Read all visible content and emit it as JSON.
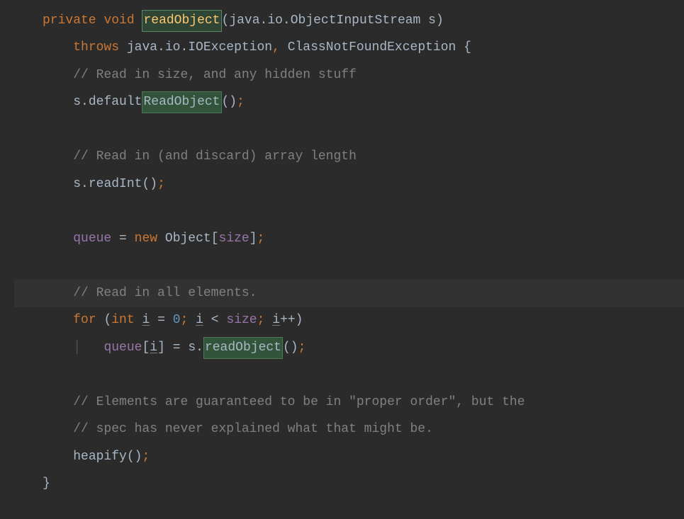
{
  "code": {
    "line1": {
      "modifier": "private",
      "returnType": "void",
      "methodName": "readObject",
      "paramType": "java.io.ObjectInputStream",
      "paramName": "s"
    },
    "line2": {
      "throws": "throws",
      "exception1": "java.io.IOException",
      "exception2": "ClassNotFoundException"
    },
    "line3": {
      "comment": "// Read in size, and any hidden stuff"
    },
    "line4": {
      "var": "s",
      "method1": "default",
      "methodHighlight": "ReadObject"
    },
    "line6": {
      "comment": "// Read in (and discard) array length"
    },
    "line7": {
      "var": "s",
      "method": "readInt"
    },
    "line9": {
      "field": "queue",
      "newKw": "new",
      "type": "Object",
      "sizeField": "size"
    },
    "line11": {
      "comment": "// Read in all elements."
    },
    "line12": {
      "forKw": "for",
      "intKw": "int",
      "var": "i",
      "zero": "0",
      "sizeField": "size",
      "incVar": "i"
    },
    "line13": {
      "field": "queue",
      "idx": "i",
      "var": "s",
      "method": "readObject"
    },
    "line15": {
      "comment": "// Elements are guaranteed to be in \"proper order\", but the"
    },
    "line16": {
      "comment": "// spec has never explained what that might be."
    },
    "line17": {
      "method": "heapify"
    }
  }
}
